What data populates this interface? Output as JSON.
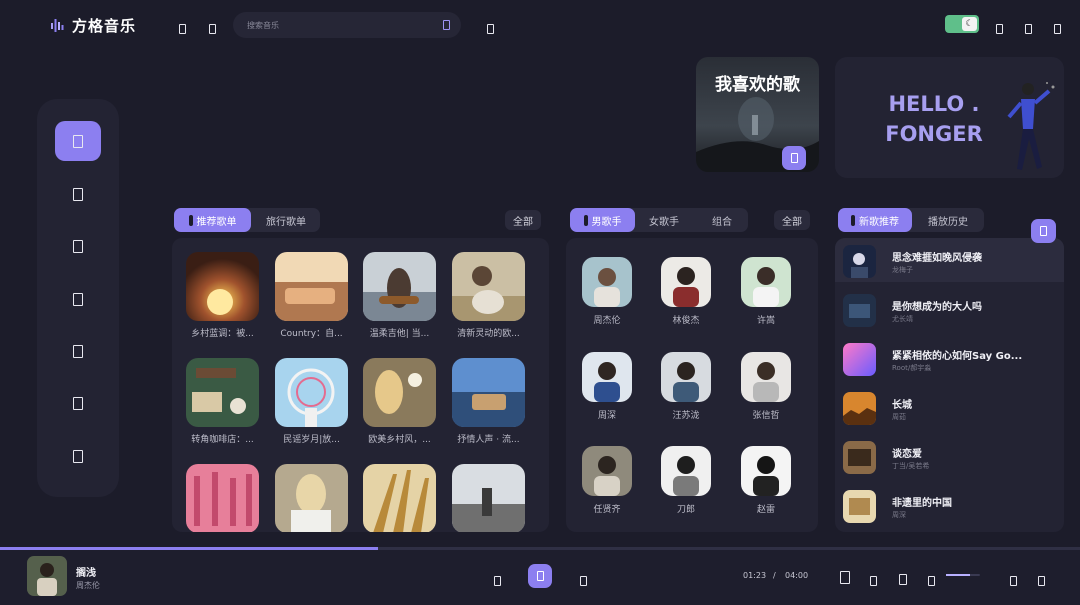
{
  "app": {
    "name": "方格音乐"
  },
  "search": {
    "placeholder": "搜索音乐"
  },
  "colors": {
    "accent": "#8c7ff0",
    "background": "#1c1c2a",
    "panel": "#232333",
    "toggle": "#5fbf8a"
  },
  "banner": {
    "favorite_title": "我喜欢的歌",
    "hello_line1": "HELLO .",
    "hello_line2": "FONGER"
  },
  "playlists": {
    "tabs": [
      "推荐歌单",
      "旅行歌单"
    ],
    "all_label": "全部",
    "items": [
      "乡村蓝调：被...",
      "Country：自...",
      "温柔吉他| 当...",
      "清新灵动的欧...",
      "转角咖啡店：...",
      "民谣岁月|放...",
      "欧美乡村风，...",
      "抒情人声 · 流..."
    ]
  },
  "singers": {
    "tabs": [
      "男歌手",
      "女歌手",
      "组合"
    ],
    "all_label": "全部",
    "items": [
      "周杰伦",
      "林俊杰",
      "许嵩",
      "周深",
      "汪苏泷",
      "张信哲",
      "任贤齐",
      "刀郎",
      "赵雷"
    ]
  },
  "songs": {
    "tabs": [
      "新歌推荐",
      "播放历史"
    ],
    "items": [
      {
        "title": "思念难捱如晚风侵袭",
        "artist": "龙梅子"
      },
      {
        "title": "是你想成为的大人吗",
        "artist": "尤长靖"
      },
      {
        "title": "紧紧相依的心如何Say Go...",
        "artist": "Root/郝宇淼"
      },
      {
        "title": "长城",
        "artist": "周茹"
      },
      {
        "title": "谈恋爱",
        "artist": "丁当/吴若希"
      },
      {
        "title": "非遗里的中国",
        "artist": "周深"
      }
    ]
  },
  "player": {
    "title": "搁浅",
    "artist": "周杰伦",
    "current_time": "01:23",
    "separator": "/",
    "total_time": "04:00",
    "progress": 0.35,
    "volume": 0.7
  },
  "icons": {
    "top": [
      "back-icon",
      "forward-icon",
      "search-icon",
      "settings-icon",
      "theme-toggle-icon",
      "minimize-icon",
      "maximize-icon",
      "close-icon"
    ],
    "sidebar": [
      "home-icon",
      "discover-icon",
      "playlist-icon",
      "video-icon",
      "favorite-icon",
      "download-icon",
      "user-icon"
    ]
  }
}
